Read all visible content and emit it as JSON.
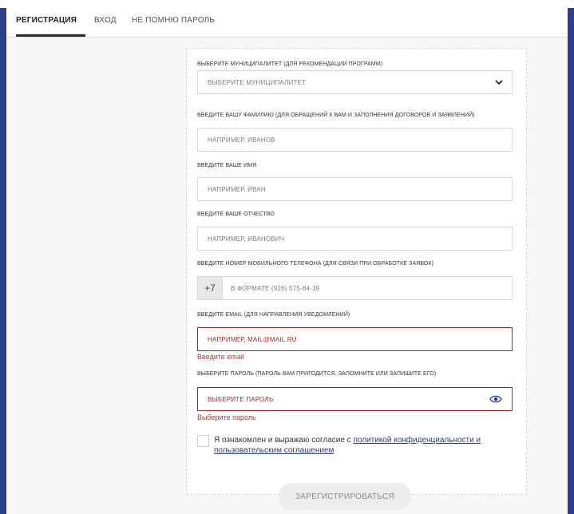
{
  "tabs": [
    {
      "label": "РЕГИСТРАЦИЯ",
      "active": true
    },
    {
      "label": "ВХОД",
      "active": false
    },
    {
      "label": "НЕ ПОМНЮ ПАРОЛЬ",
      "active": false
    }
  ],
  "form": {
    "municipality": {
      "label": "ВЫБЕРИТЕ МУНИЦИПАЛИТЕТ (ДЛЯ РЕКОМЕНДАЦИИ ПРОГРАММ)",
      "selected": "ВЫБЕРИТЕ МУНИЦИПАЛИТЕТ"
    },
    "surname": {
      "label": "ВВЕДИТЕ ВАШУ ФАМИЛИЮ (ДЛЯ ОБРАЩЕНИЙ К ВАМ И ЗАПОЛНЕНИЯ ДОГОВОРОВ И ЗАЯВЛЕНИЙ)",
      "placeholder": "НАПРИМЕР, ИВАНОВ"
    },
    "name": {
      "label": "ВВЕДИТЕ ВАШЕ ИМЯ",
      "placeholder": "НАПРИМЕР, ИВАН"
    },
    "patronymic": {
      "label": "ВВЕДИТЕ ВАШЕ ОТЧЕСТВО",
      "placeholder": "НАПРИМЕР, ИВАНОВИЧ"
    },
    "phone": {
      "label": "ВВЕДИТЕ НОМЕР МОБИЛЬНОГО ТЕЛЕФОНА (ДЛЯ СВЯЗИ ПРИ ОБРАБОТКЕ ЗАЯВОК)",
      "prefix": "+7",
      "placeholder": "В ФОРМАТЕ (926) 575-84-39"
    },
    "email": {
      "label": "ВВЕДИТЕ EMAIL (ДЛЯ НАПРАВЛЕНИЯ УВЕДОМЛЕНИЙ)",
      "placeholder": "НАПРИМЕР, MAIL@MAIL.RU",
      "error": "Введите email"
    },
    "password": {
      "label": "ВЫБЕРИТЕ ПАРОЛЬ (ПАРОЛЬ ВАМ ПРИГОДИТСЯ, ЗАПОМНИТЕ ИЛИ ЗАПИШИТЕ ЕГО)",
      "placeholder": "ВЫБЕРИТЕ ПАРОЛЬ",
      "error": "Выберите пароль"
    },
    "consent": {
      "text": "Я ознакомлен и выражаю согласие с ",
      "link_text": "политикой конфиденциальности и пользовательским соглашением"
    },
    "submit_label": "ЗАРЕГИСТРИРОВАТЬСЯ"
  },
  "colors": {
    "accent": "#2b3f8a",
    "error": "#b23636",
    "link": "#2a3b7a"
  }
}
